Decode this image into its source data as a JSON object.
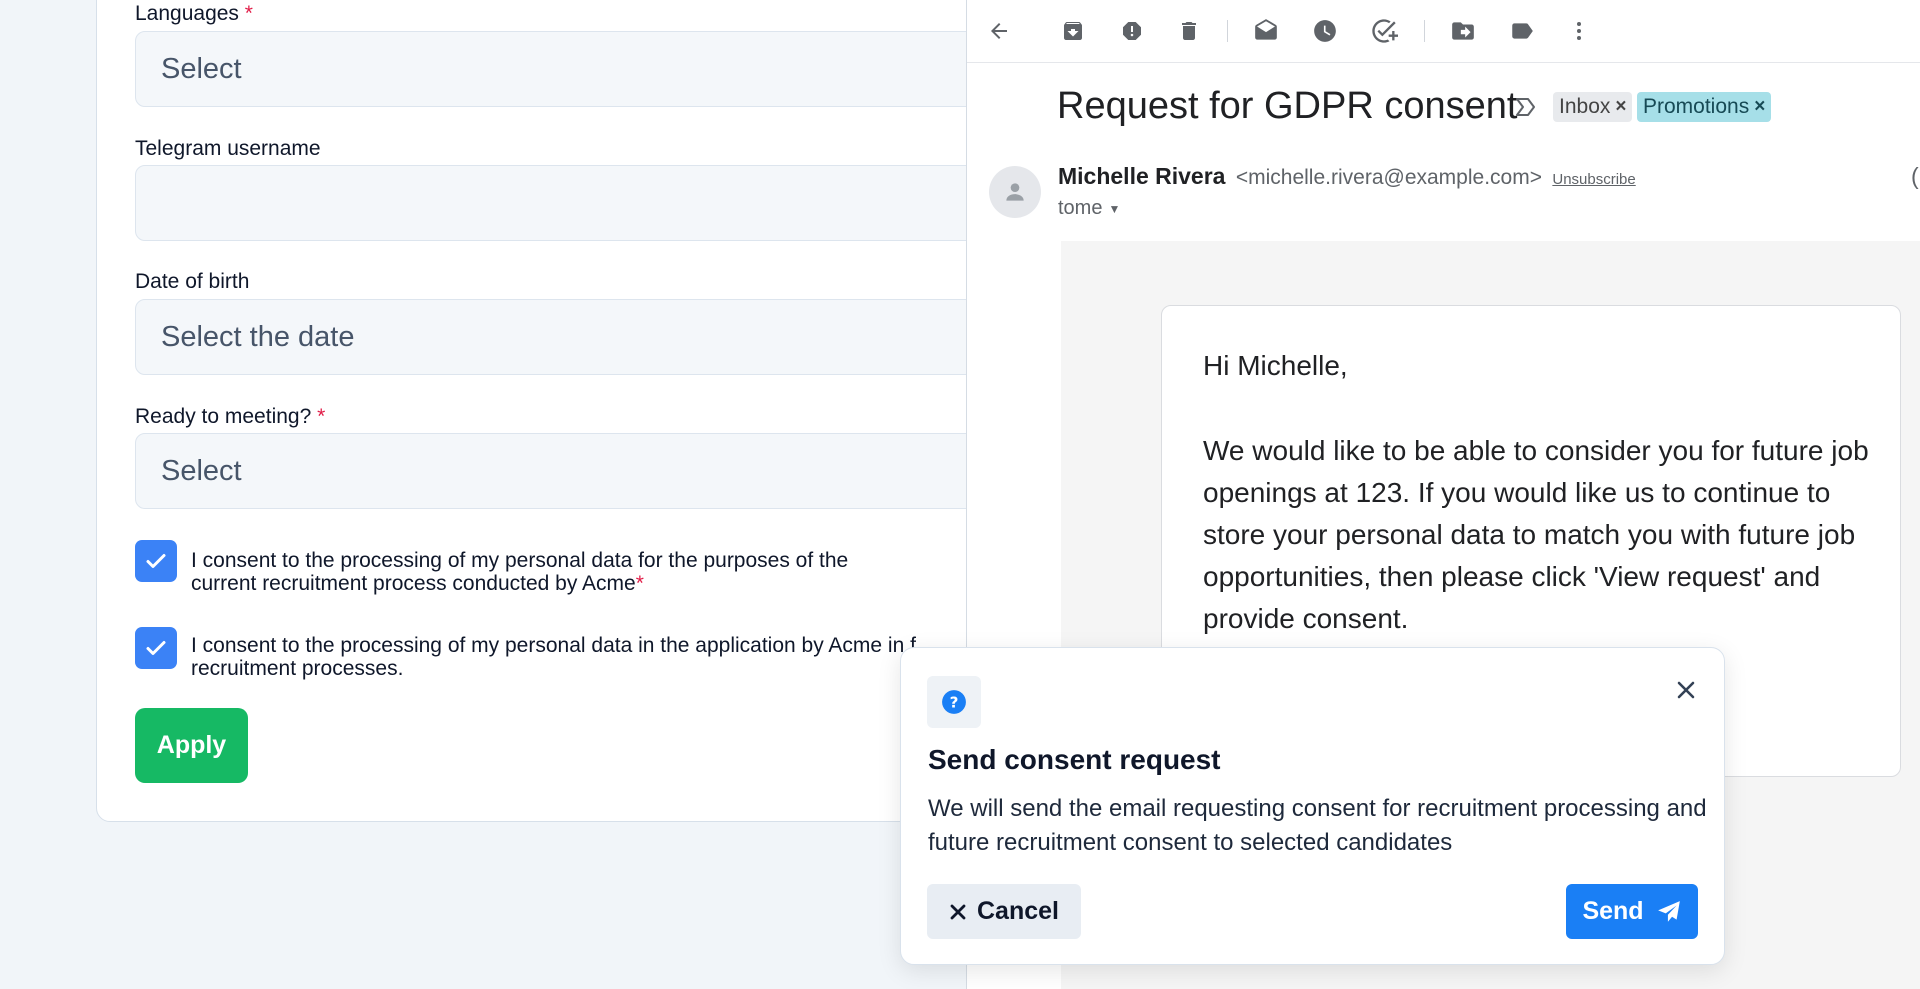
{
  "form": {
    "languages": {
      "label": "Languages",
      "required_mark": "*",
      "value": "Select"
    },
    "telegram": {
      "label": "Telegram username",
      "value": ""
    },
    "dob": {
      "label": "Date of birth",
      "value": "Select the date"
    },
    "ready": {
      "label": "Ready to meeting?",
      "required_mark": "*",
      "value": "Select"
    },
    "consent1": {
      "text_line1": "I consent to the processing of my personal data for the purposes of the",
      "text_line2": "current recruitment process conducted by Acme",
      "required_mark": "*",
      "checked": true
    },
    "consent2": {
      "text_line1": "I consent to the processing of my personal data in the application by Acme in f",
      "text_line2": "recruitment processes.",
      "checked": true
    },
    "apply_label": "Apply"
  },
  "email": {
    "subject": "Request for GDPR consent",
    "labels": [
      {
        "name": "Inbox",
        "remove": "×"
      },
      {
        "name": "Promotions",
        "remove": "×"
      }
    ],
    "sender_name": "Michelle Rivera",
    "sender_email": "<michelle.rivera@example.com>",
    "unsubscribe": "Unsubscribe",
    "truncated_paren": "(",
    "to": "tome",
    "greeting": "Hi Michelle,",
    "body": "We would like to be able to consider you for future job openings at 123. If you would like us to continue to store your personal data to match you with future job opportunities, then please click 'View request' and provide consent.",
    "toolbar_icons": [
      "back-arrow-icon",
      "archive-icon",
      "report-spam-icon",
      "delete-icon",
      "mark-unread-icon",
      "snooze-icon",
      "add-task-icon",
      "move-to-icon",
      "label-icon",
      "more-vert-icon"
    ]
  },
  "modal": {
    "title": "Send consent request",
    "text": "We will send the email requesting consent for recruitment processing and future recruitment consent to selected candidates",
    "cancel_label": "Cancel",
    "send_label": "Send"
  },
  "colors": {
    "accent_blue": "#1a7ff5",
    "checkbox_blue": "#3b82f6",
    "apply_green": "#16b964",
    "required_red": "#e11d48",
    "promo_chip": "#a6dfe8"
  }
}
